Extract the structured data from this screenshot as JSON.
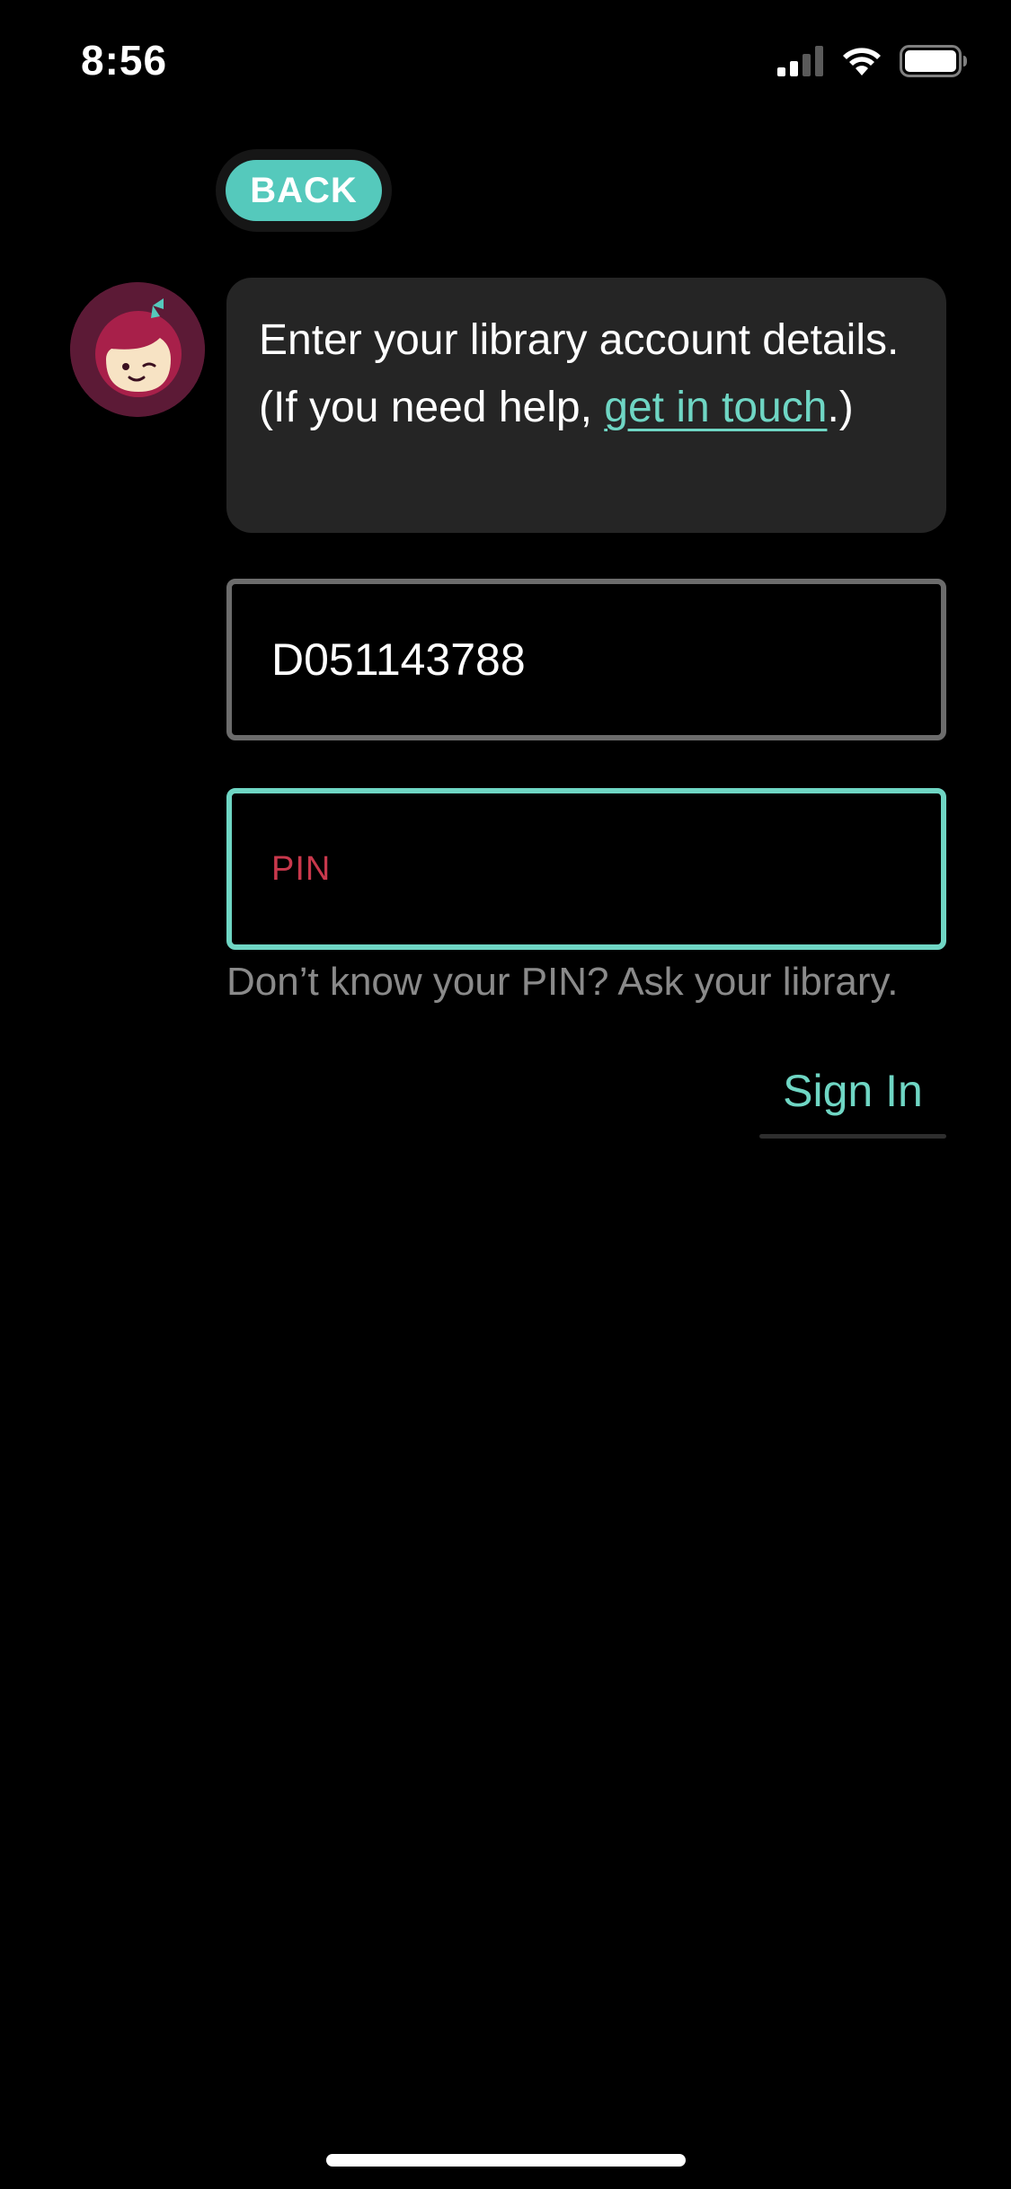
{
  "status_bar": {
    "time": "8:56",
    "icons": [
      "signal-icon",
      "wifi-icon",
      "battery-icon"
    ]
  },
  "back_button": {
    "label": "BACK"
  },
  "message": {
    "text_before_link": "Enter your library account details. (If you need help, ",
    "link_text": "get in touch",
    "text_after_link": ".)"
  },
  "card_field": {
    "value": "D051143788"
  },
  "pin_field": {
    "placeholder": "PIN",
    "value": ""
  },
  "hint": {
    "text": "Don’t know your PIN? Ask your library."
  },
  "sign_in": {
    "label": "Sign In"
  },
  "colors": {
    "background": "#000000",
    "accent": "#6fd6c4",
    "back_button": "#55c9bc",
    "bubble": "#252525",
    "placeholder": "#c8384c",
    "avatar_bg": "#5c1a36"
  }
}
